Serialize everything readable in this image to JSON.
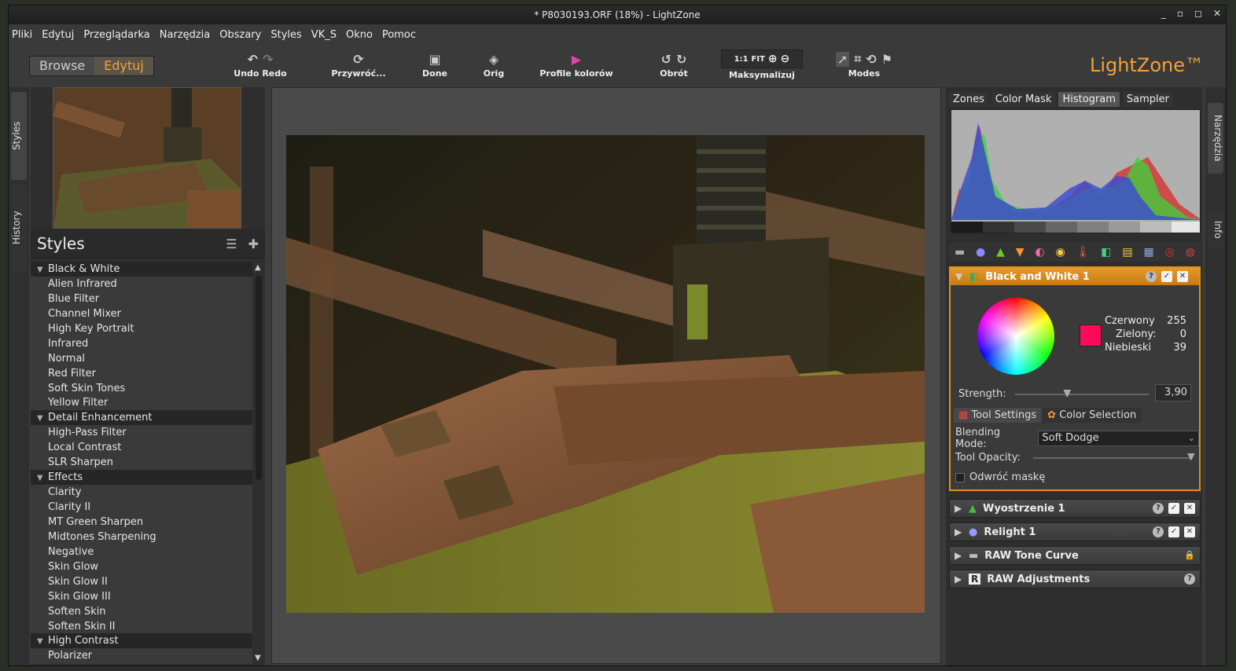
{
  "window": {
    "title": "* P8030193.ORF (18%) - LightZone",
    "controls": [
      "_",
      "▫",
      "◻",
      "✕"
    ]
  },
  "menu": [
    "Pliki",
    "Edytuj",
    "Przeglądarka",
    "Narzędzia",
    "Obszary",
    "Styles",
    "VK_S",
    "Okno",
    "Pomoc"
  ],
  "modes": {
    "browse": "Browse",
    "edit": "Edytuj"
  },
  "toolbar": {
    "undo_redo": "Undo Redo",
    "restore": "Przywróć...",
    "done": "Done",
    "orig": "Orig",
    "profiles": "Profile kolorów",
    "rotate": "Obrót",
    "zoom_1_1": "1:1",
    "zoom_fit": "FIT",
    "maximize": "Maksymalizuj",
    "modes": "Modes"
  },
  "logo": "LightZone™",
  "left_tabs": {
    "styles": "Styles",
    "history": "History"
  },
  "styles_panel": {
    "title": "Styles",
    "items": [
      {
        "label": "Black & White",
        "group": true
      },
      {
        "label": "Alien Infrared"
      },
      {
        "label": "Blue Filter"
      },
      {
        "label": "Channel Mixer"
      },
      {
        "label": "High Key Portrait"
      },
      {
        "label": "Infrared"
      },
      {
        "label": "Normal"
      },
      {
        "label": "Red Filter"
      },
      {
        "label": "Soft Skin Tones"
      },
      {
        "label": "Yellow Filter"
      },
      {
        "label": "Detail Enhancement",
        "group": true
      },
      {
        "label": "High-Pass Filter"
      },
      {
        "label": "Local Contrast"
      },
      {
        "label": "SLR Sharpen"
      },
      {
        "label": "Effects",
        "group": true
      },
      {
        "label": "Clarity"
      },
      {
        "label": "Clarity II"
      },
      {
        "label": "MT Green Sharpen"
      },
      {
        "label": "Midtones Sharpening"
      },
      {
        "label": "Negative"
      },
      {
        "label": "Skin Glow"
      },
      {
        "label": "Skin Glow II"
      },
      {
        "label": "Skin Glow III"
      },
      {
        "label": "Soften Skin"
      },
      {
        "label": "Soften Skin II"
      },
      {
        "label": "High Contrast",
        "group": true
      },
      {
        "label": "Polarizer"
      }
    ]
  },
  "right_tabs": [
    "Zones",
    "Color Mask",
    "Histogram",
    "Sampler"
  ],
  "right_vtabs": {
    "tools": "Narzędzia",
    "info": "Info"
  },
  "bw_tool": {
    "title": "Black and White 1",
    "help": "?",
    "check": "✓",
    "close": "✕",
    "red_label": "Czerwony",
    "red_value": "255",
    "green_label": "Zielony:",
    "green_value": "0",
    "blue_label": "Niebieski",
    "blue_value": "39",
    "swatch_color": "#ff0a5a",
    "strength_label": "Strength:",
    "strength_value": "3,90",
    "strength_fraction": 0.39,
    "tab_tool_settings": "Tool Settings",
    "tab_color_selection": "Color Selection",
    "blending_label": "Blending Mode:",
    "blending_value": "Soft Dodge",
    "opacity_label": "Tool Opacity:",
    "invert_label": "Odwróć maskę"
  },
  "tool_stack": [
    {
      "label": "Wyostrzenie 1",
      "icon": "triangle-green-icon",
      "help": "?",
      "check": "✓",
      "close": "✕"
    },
    {
      "label": "Relight 1",
      "icon": "moon-icon",
      "help": "?",
      "check": "✓",
      "close": "✕"
    },
    {
      "label": "RAW Tone Curve",
      "icon": "tone-curve-icon",
      "lock": "🔒"
    },
    {
      "label": "RAW Adjustments",
      "icon": "raw-r-icon",
      "help": "?"
    }
  ]
}
